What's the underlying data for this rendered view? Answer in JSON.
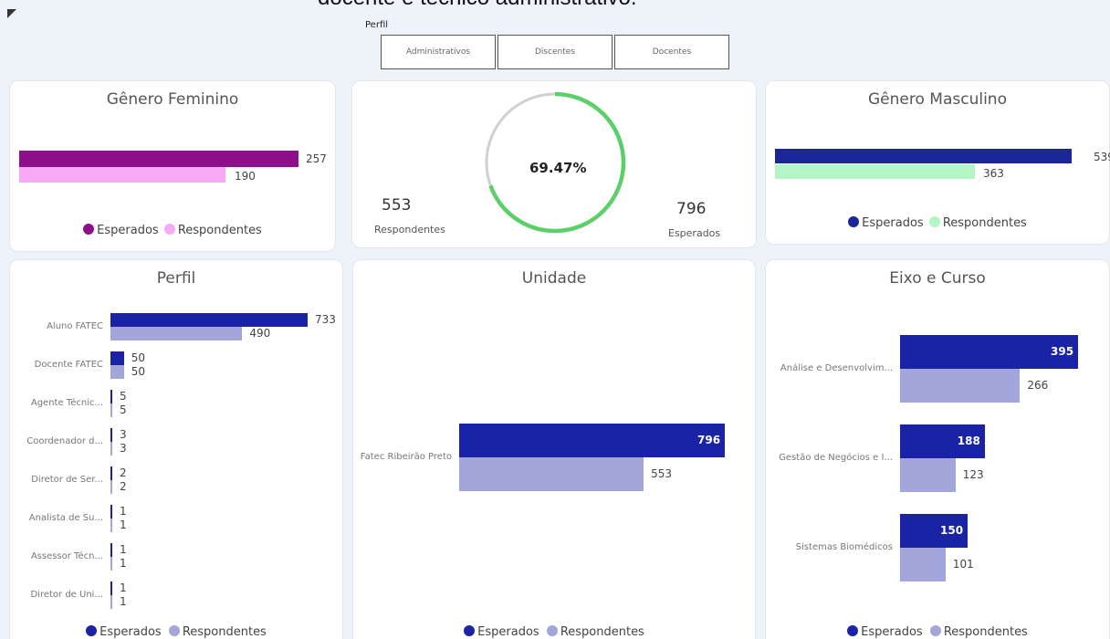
{
  "header": {
    "cut_title": "docente e técnico administrativo.",
    "filter_label": "Perfil",
    "filter_options": [
      "Administrativos",
      "Discentes",
      "Docentes"
    ]
  },
  "colors": {
    "female_esperados": "#8e0f8b",
    "female_respondentes": "#f7a9f5",
    "male_esperados": "#1a2699",
    "male_respondentes": "#b4f5c6",
    "esperados": "#1a23a6",
    "respondentes": "#a3a6db",
    "gauge": "#5ccf6a",
    "gauge_track": "#d0d0d0"
  },
  "female_card": {
    "title": "Gênero Feminino",
    "esperados": 257,
    "respondentes": 190,
    "legend_esperados": "Esperados",
    "legend_respondentes": "Respondentes"
  },
  "gauge_card": {
    "percent_label": "69.47%",
    "percent": 69.47,
    "respondentes_value": "553",
    "respondentes_label": "Respondentes",
    "esperados_value": "796",
    "esperados_label": "Esperados"
  },
  "male_card": {
    "title": "Gênero Masculino",
    "esperados": 539,
    "respondentes": 363,
    "legend_esperados": "Esperados",
    "legend_respondentes": "Respondentes"
  },
  "perfil_card": {
    "title": "Perfil",
    "rows": [
      {
        "label": "Aluno FATEC",
        "esperados": 733,
        "respondentes": 490
      },
      {
        "label": "Docente FATEC",
        "esperados": 50,
        "respondentes": 50
      },
      {
        "label": "Agente Técnic...",
        "esperados": 5,
        "respondentes": 5
      },
      {
        "label": "Coordenador d...",
        "esperados": 3,
        "respondentes": 3
      },
      {
        "label": "Diretor de Ser...",
        "esperados": 2,
        "respondentes": 2
      },
      {
        "label": "Analista de Su...",
        "esperados": 1,
        "respondentes": 1
      },
      {
        "label": "Assessor Técn...",
        "esperados": 1,
        "respondentes": 1
      },
      {
        "label": "Diretor de Uni...",
        "esperados": 1,
        "respondentes": 1
      }
    ],
    "legend_esperados": "Esperados",
    "legend_respondentes": "Respondentes"
  },
  "unidade_card": {
    "title": "Unidade",
    "rows": [
      {
        "label": "Fatec Ribeirão Preto",
        "esperados": 796,
        "respondentes": 553
      }
    ],
    "legend_esperados": "Esperados",
    "legend_respondentes": "Respondentes"
  },
  "eixo_card": {
    "title": "Eixo e Curso",
    "rows": [
      {
        "label": "Análise e Desenvolvim...",
        "esperados": 395,
        "respondentes": 266
      },
      {
        "label": "Gestão de Negócios e I...",
        "esperados": 188,
        "respondentes": 123
      },
      {
        "label": "Sistemas Biomédicos",
        "esperados": 150,
        "respondentes": 101
      }
    ],
    "legend_esperados": "Esperados",
    "legend_respondentes": "Respondentes"
  }
}
